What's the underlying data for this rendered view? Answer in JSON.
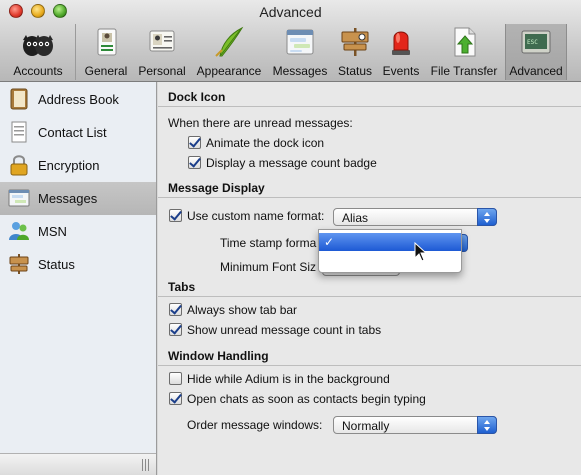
{
  "window": {
    "title": "Advanced"
  },
  "toolbar": {
    "items": [
      {
        "label": "Accounts",
        "icon": "accounts-icon"
      },
      {
        "label": "General",
        "icon": "general-icon"
      },
      {
        "label": "Personal",
        "icon": "personal-icon"
      },
      {
        "label": "Appearance",
        "icon": "appearance-icon"
      },
      {
        "label": "Messages",
        "icon": "messages-icon"
      },
      {
        "label": "Status",
        "icon": "status-icon"
      },
      {
        "label": "Events",
        "icon": "events-icon"
      },
      {
        "label": "File Transfer",
        "icon": "file-transfer-icon"
      },
      {
        "label": "Advanced",
        "icon": "advanced-icon",
        "selected": true
      }
    ]
  },
  "sidebar": {
    "items": [
      {
        "label": "Address Book",
        "icon": "address-book-icon"
      },
      {
        "label": "Contact List",
        "icon": "contact-list-icon"
      },
      {
        "label": "Encryption",
        "icon": "lock-icon"
      },
      {
        "label": "Messages",
        "icon": "messages-icon",
        "selected": true
      },
      {
        "label": "MSN",
        "icon": "msn-icon"
      },
      {
        "label": "Status",
        "icon": "status-sign-icon"
      }
    ]
  },
  "dock_icon": {
    "heading": "Dock Icon",
    "intro": "When there are unread messages:",
    "animate_label": "Animate the dock icon",
    "animate_checked": true,
    "badge_label": "Display a message count badge",
    "badge_checked": true
  },
  "message_display": {
    "heading": "Message Display",
    "custom_name_label": "Use custom name format:",
    "custom_name_checked": true,
    "name_format_value": "Alias",
    "timestamp_label": "Time stamp forma",
    "min_font_label": "Minimum Font Siz",
    "timestamp_menu_check": "✓"
  },
  "tabs": {
    "heading": "Tabs",
    "always_show_label": "Always show tab bar",
    "always_show_checked": true,
    "unread_count_label": "Show unread message count in tabs",
    "unread_count_checked": true
  },
  "window_handling": {
    "heading": "Window Handling",
    "hide_label": "Hide while Adium is in the background",
    "hide_checked": false,
    "open_chats_label": "Open chats as soon as contacts begin typing",
    "open_chats_checked": true,
    "order_label": "Order message windows:",
    "order_value": "Normally"
  }
}
